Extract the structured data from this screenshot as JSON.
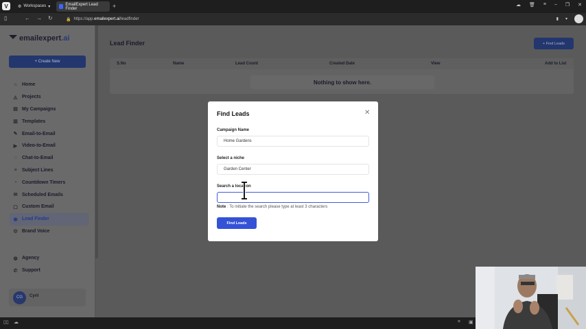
{
  "browser": {
    "workspace_label": "Workspaces",
    "tab_title": "EmailExpert Lead Finder",
    "url_prefix": "https://app.",
    "url_host": "emailexpert.ai",
    "url_path": "/leadfinder"
  },
  "brand": {
    "name": "emailexpert",
    "suffix": ".ai"
  },
  "sidebar": {
    "create_label": "+ Create New",
    "items": [
      {
        "label": "Home",
        "icon": "home-icon"
      },
      {
        "label": "Projects",
        "icon": "projects-icon"
      },
      {
        "label": "My Campaigns",
        "icon": "campaigns-icon"
      },
      {
        "label": "Templates",
        "icon": "templates-icon"
      },
      {
        "label": "Email-to-Email",
        "icon": "email-icon"
      },
      {
        "label": "Video-to-Email",
        "icon": "video-icon"
      },
      {
        "label": "Chat-to-Email",
        "icon": "chat-icon"
      },
      {
        "label": "Subject Lines",
        "icon": "subject-icon"
      },
      {
        "label": "Countdown Timers",
        "icon": "timer-icon"
      },
      {
        "label": "Scheduled Emails",
        "icon": "schedule-icon"
      },
      {
        "label": "Custom Email",
        "icon": "custom-icon"
      },
      {
        "label": "Lead Finder",
        "icon": "lead-icon"
      },
      {
        "label": "Brand Voice",
        "icon": "brand-icon"
      }
    ],
    "secondary": [
      {
        "label": "Agency",
        "icon": "agency-icon"
      },
      {
        "label": "Support",
        "icon": "support-icon"
      }
    ],
    "user": {
      "initials": "CG",
      "name": "Cyril"
    }
  },
  "main": {
    "title": "Lead Finder",
    "find_leads_button": "+ Find Leads",
    "columns": [
      "S.No",
      "Name",
      "Lead Count",
      "Created Date",
      "View",
      "Add to List"
    ],
    "empty_text": "Nothing to show here."
  },
  "modal": {
    "title": "Find Leads",
    "campaign_label": "Campaign Name",
    "campaign_value": "Home Gardens",
    "niche_label": "Select a niche",
    "niche_value": "Garden Center",
    "location_label": "Search a location",
    "location_value": "",
    "note_prefix": "Note",
    "note_text": " : To initiate the search please type at least 3 characters",
    "submit_label": "Find Leads"
  }
}
